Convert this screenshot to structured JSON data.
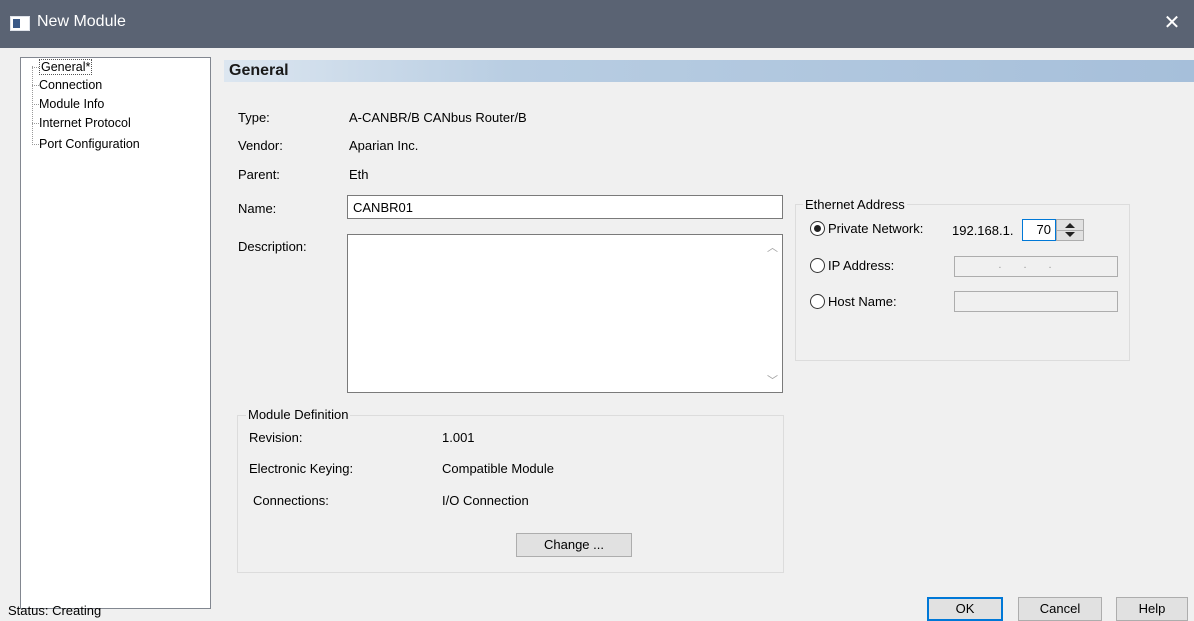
{
  "window": {
    "title": "New Module",
    "close_glyph": "✕",
    "icon": "window-app-icon"
  },
  "tree": {
    "items": [
      {
        "label": "General*",
        "selected": true
      },
      {
        "label": "Connection"
      },
      {
        "label": "Module Info"
      },
      {
        "label": "Internet Protocol"
      },
      {
        "label": "Port Configuration"
      }
    ]
  },
  "section": {
    "title": "General"
  },
  "fields": {
    "type_label": "Type:",
    "type_value": "A-CANBR/B CANbus Router/B",
    "vendor_label": "Vendor:",
    "vendor_value": "Aparian Inc.",
    "parent_label": "Parent:",
    "parent_value": "Eth",
    "name_label": "Name:",
    "name_value": "CANBR01",
    "description_label": "Description:",
    "description_value": ""
  },
  "module_definition": {
    "title": "Module Definition",
    "revision_label": "Revision:",
    "revision_value": "1.001",
    "keying_label": "Electronic Keying:",
    "keying_value": "Compatible Module",
    "connections_label": "Connections:",
    "connections_value": "I/O Connection",
    "change_button": "Change ..."
  },
  "ethernet": {
    "title": "Ethernet Address",
    "private_label": "Private Network:",
    "private_prefix": "192.168.1.",
    "private_octet": "70",
    "ip_label": "IP Address:",
    "host_label": "Host Name:",
    "selected": "private"
  },
  "status": {
    "text": "Status:  Creating"
  },
  "buttons": {
    "ok": "OK",
    "cancel": "Cancel",
    "help": "Help"
  },
  "colors": {
    "titlebar": "#5a6373",
    "accent": "#0078d7",
    "header_gradient_end": "#a6bfda"
  }
}
